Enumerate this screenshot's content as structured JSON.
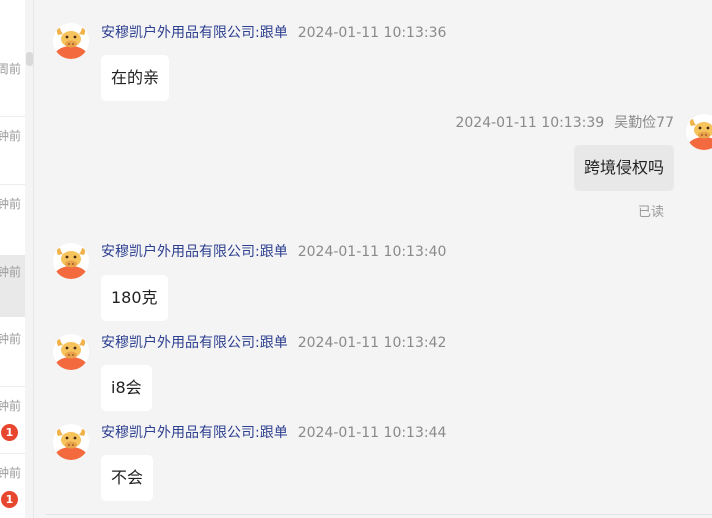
{
  "conversation_list": {
    "items": [
      {
        "time": "周前",
        "badge": null
      },
      {
        "time": "钟前",
        "badge": null
      },
      {
        "time": "钟前",
        "badge": null
      },
      {
        "time": "钟前",
        "badge": null
      },
      {
        "time": "钟前",
        "badge": null
      },
      {
        "time": "钟前",
        "badge": "1"
      },
      {
        "time": "钟前",
        "badge": "1"
      }
    ]
  },
  "messages": [
    {
      "sender": "安穆凯户外用品有限公司:跟单",
      "time": "2024-01-11 10:13:36",
      "text": "在的亲",
      "mine": false
    },
    {
      "sender": "吴勤俭77",
      "time": "2024-01-11 10:13:39",
      "text": "跨境侵权吗",
      "mine": true,
      "status": "已读"
    },
    {
      "sender": "安穆凯户外用品有限公司:跟单",
      "time": "2024-01-11 10:13:40",
      "text": "180克",
      "mine": false
    },
    {
      "sender": "安穆凯户外用品有限公司:跟单",
      "time": "2024-01-11 10:13:42",
      "text": "i8会",
      "mine": false
    },
    {
      "sender": "安穆凯户外用品有限公司:跟单",
      "time": "2024-01-11 10:13:44",
      "text": "不会",
      "mine": false
    }
  ],
  "colors": {
    "sender_name": "#2d3f8f",
    "badge": "#e8472f",
    "my_bubble": "#e8e8e8",
    "their_bubble": "#ffffff"
  },
  "icons": {
    "avatar": "cartoon-bull-avatar-icon"
  }
}
